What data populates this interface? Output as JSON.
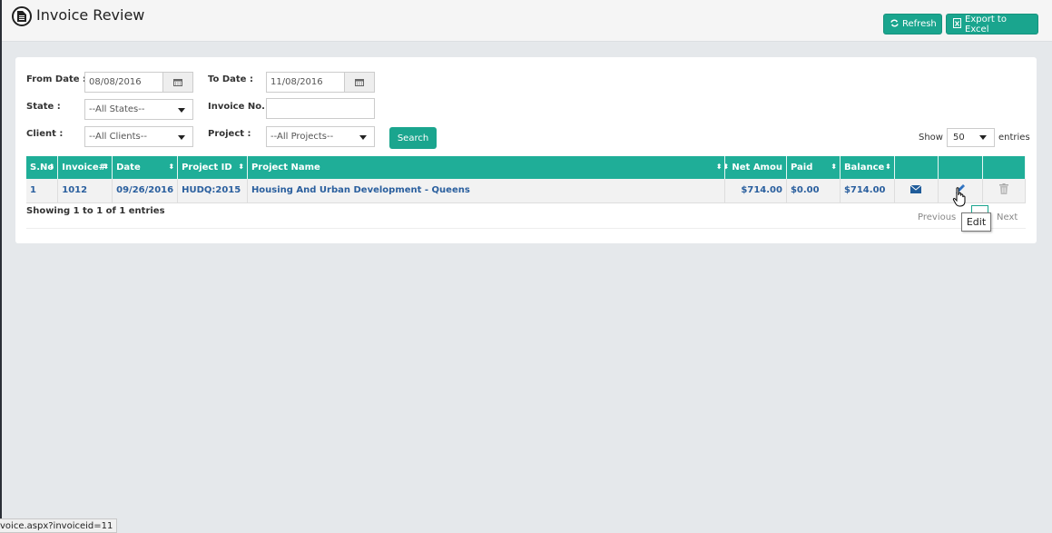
{
  "header": {
    "title": "Invoice Review",
    "title_icon": "document-icon",
    "buttons": {
      "refresh": {
        "label": "Refresh",
        "icon": "refresh-icon"
      },
      "export": {
        "label": "Export to Excel",
        "icon": "excel-file-icon"
      }
    }
  },
  "filters": {
    "from_date": {
      "label": "From Date :",
      "value": "08/08/2016",
      "icon": "calendar-icon"
    },
    "to_date": {
      "label": "To Date :",
      "value": "11/08/2016",
      "icon": "calendar-icon"
    },
    "state": {
      "label": "State :",
      "selected": "--All States--"
    },
    "invoice_no": {
      "label": "Invoice No. :",
      "value": ""
    },
    "client": {
      "label": "Client :",
      "selected": "--All Clients--"
    },
    "project": {
      "label": "Project :",
      "selected": "--All Projects--"
    },
    "search_label": "Search"
  },
  "show_entries": {
    "prefix": "Show",
    "selected": "50",
    "suffix": "entries"
  },
  "table": {
    "columns": [
      "S.No",
      "Invoice#",
      "Date",
      "Project ID",
      "Project Name",
      "Net Amount",
      "Paid",
      "Balance",
      "",
      "",
      ""
    ],
    "column_display": [
      "S.No",
      "Invoice#",
      "Date",
      "Project ID",
      "Project Name",
      "Net Amou",
      "Paid",
      "Balance",
      "",
      "",
      ""
    ],
    "rows": [
      {
        "sno": "1",
        "invoice": "1012",
        "date": "09/26/2016",
        "project_id": "HUDQ:2015",
        "project_name": "Housing And Urban Development - Queens",
        "net_amount": "$714.00",
        "paid": "$0.00",
        "balance": "$714.00",
        "actions": [
          "email-icon",
          "edit-icon",
          "delete-icon"
        ]
      }
    ]
  },
  "info": "Showing 1 to 1 of 1 entries",
  "pagination": {
    "previous": "Previous",
    "next": "Next"
  },
  "tooltip": "Edit",
  "status_bar_url": "voice.aspx?invoiceid=11",
  "colors": {
    "accent": "#1aa58e",
    "header_row": "#1fae98",
    "link": "#2a5f9e"
  }
}
